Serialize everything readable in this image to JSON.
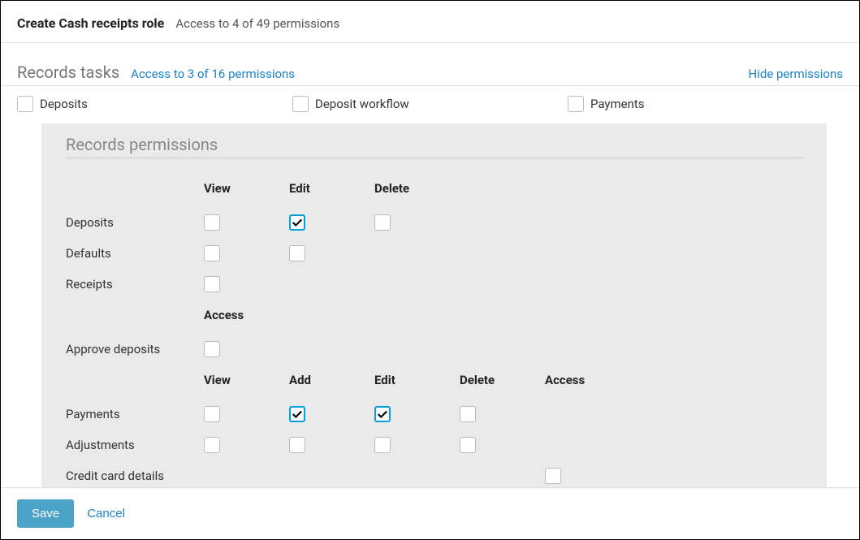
{
  "header": {
    "title": "Create Cash receipts role",
    "subtitle": "Access to 4 of 49 permissions"
  },
  "section": {
    "title": "Records tasks",
    "subtitle": "Access to 3 of 16 permissions",
    "hide_link": "Hide permissions"
  },
  "tasks": [
    {
      "label": "Deposits",
      "checked": false
    },
    {
      "label": "Deposit workflow",
      "checked": false
    },
    {
      "label": "Payments",
      "checked": false
    }
  ],
  "panel": {
    "title": "Records permissions",
    "columns1": [
      "View",
      "Edit",
      "Delete"
    ],
    "rows1": [
      {
        "label": "Deposits",
        "cells": [
          false,
          true,
          false
        ]
      },
      {
        "label": "Defaults",
        "cells": [
          false,
          false,
          null
        ]
      },
      {
        "label": "Receipts",
        "cells": [
          false,
          null,
          null
        ]
      }
    ],
    "columns2": [
      "Access"
    ],
    "rows2": [
      {
        "label": "Approve deposits",
        "cells": [
          false
        ]
      }
    ],
    "columns3": [
      "View",
      "Add",
      "Edit",
      "Delete",
      "Access"
    ],
    "rows3": [
      {
        "label": "Payments",
        "cells": [
          false,
          true,
          true,
          false,
          null
        ]
      },
      {
        "label": "Adjustments",
        "cells": [
          false,
          false,
          false,
          false,
          null
        ]
      },
      {
        "label": "Credit card details",
        "cells": [
          null,
          null,
          null,
          null,
          false
        ]
      }
    ]
  },
  "footer": {
    "save": "Save",
    "cancel": "Cancel"
  }
}
